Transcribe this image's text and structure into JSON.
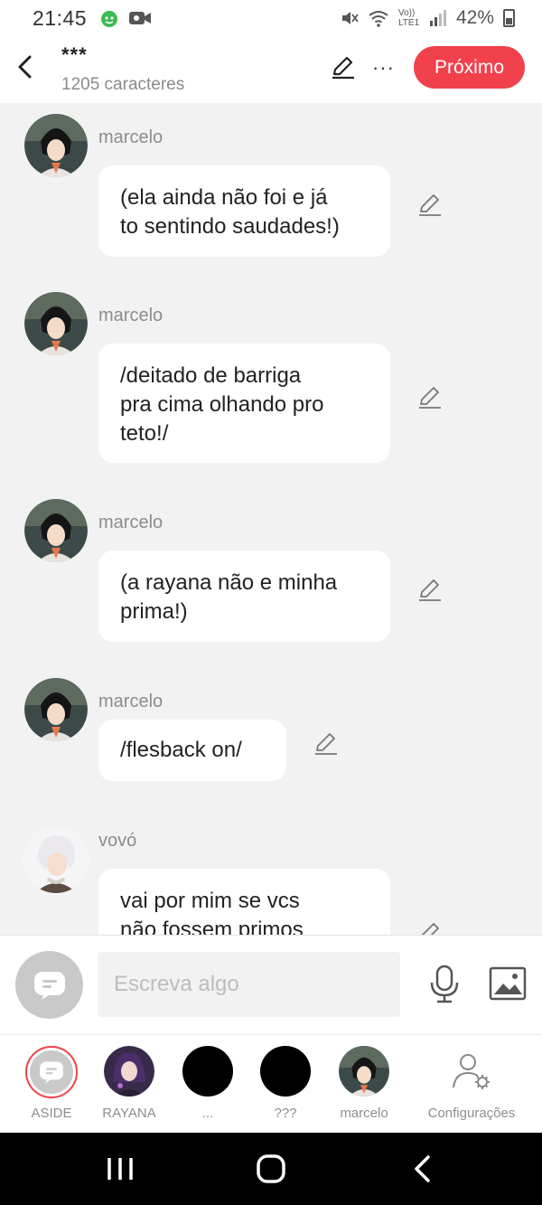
{
  "status_bar": {
    "time": "21:45",
    "battery": "42%",
    "network": "Vo)) LTE1"
  },
  "header": {
    "title": "***",
    "subtitle": "1205 caracteres",
    "more_label": "···",
    "next_button": "Próximo"
  },
  "messages": [
    {
      "sender": "marcelo",
      "text_lines": [
        "(ela ainda não foi e já",
        "to sentindo saudades!)"
      ]
    },
    {
      "sender": "marcelo",
      "text_lines": [
        "/deitado de barriga",
        "pra cima olhando pro",
        "teto!/"
      ]
    },
    {
      "sender": "marcelo",
      "text_lines": [
        "(a rayana não e minha",
        "prima!)"
      ]
    },
    {
      "sender": "marcelo",
      "text_lines": [
        "/flesback on/"
      ]
    },
    {
      "sender": "vovó",
      "text_lines": [
        "vai por mim se vcs",
        "não fossem primos"
      ]
    }
  ],
  "composer": {
    "placeholder": "Escreva algo"
  },
  "tabs": [
    {
      "label": "ASIDE",
      "icon": "chat-bubble-icon"
    },
    {
      "label": "RAYANA",
      "icon": "avatar"
    },
    {
      "label": "...",
      "icon": "avatar"
    },
    {
      "label": "???",
      "icon": "avatar"
    },
    {
      "label": "marcelo",
      "icon": "avatar"
    },
    {
      "label": "Configurações",
      "icon": "settings-user-icon"
    }
  ],
  "colors": {
    "accent": "#f1414c",
    "background": "#f2f2f3",
    "bubble": "#ffffff"
  }
}
